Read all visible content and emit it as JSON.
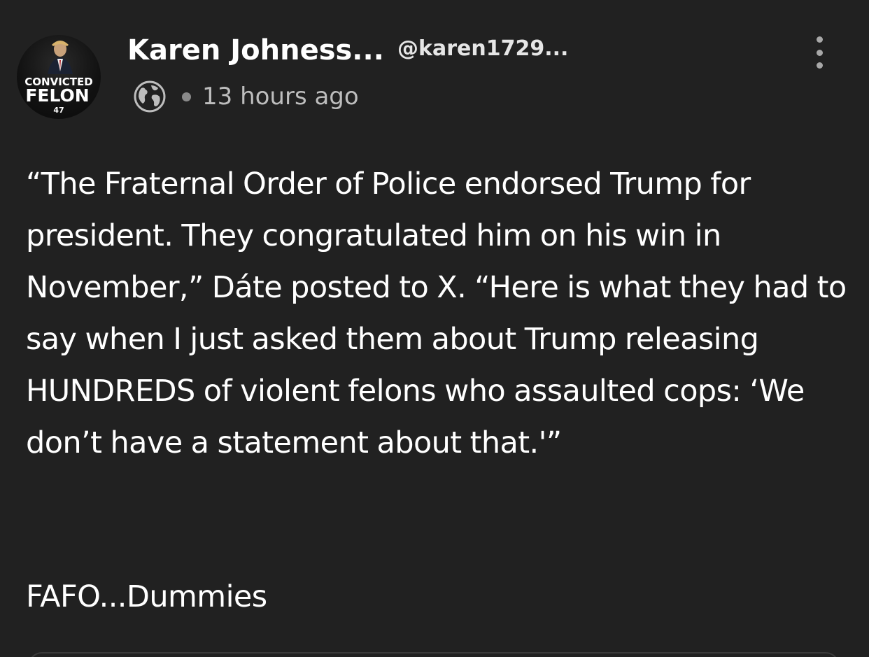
{
  "post": {
    "author": {
      "name": "Karen Johness...",
      "handle": "@karen1729...",
      "avatar": {
        "badge_line1": "CONVICTED",
        "badge_line2": "FELON",
        "badge_number": "47"
      }
    },
    "meta": {
      "visibility_icon": "globe-icon",
      "timestamp": "13 hours ago"
    },
    "menu_icon": "kebab-menu-icon",
    "body": "“The Fraternal Order of Police endorsed Trump for president. They congratulated him on his win in November,” Dáte posted to X. “Here is what they had to say when I just asked them about Trump releasing HUNDREDS of violent felons who assaulted cops: ‘We don’t have a statement about that.'”",
    "footer_text": "FAFO...Dummies"
  },
  "colors": {
    "background": "#212121",
    "text": "#ffffff",
    "muted": "#bdbdbd",
    "icon": "#a8a8a8"
  }
}
